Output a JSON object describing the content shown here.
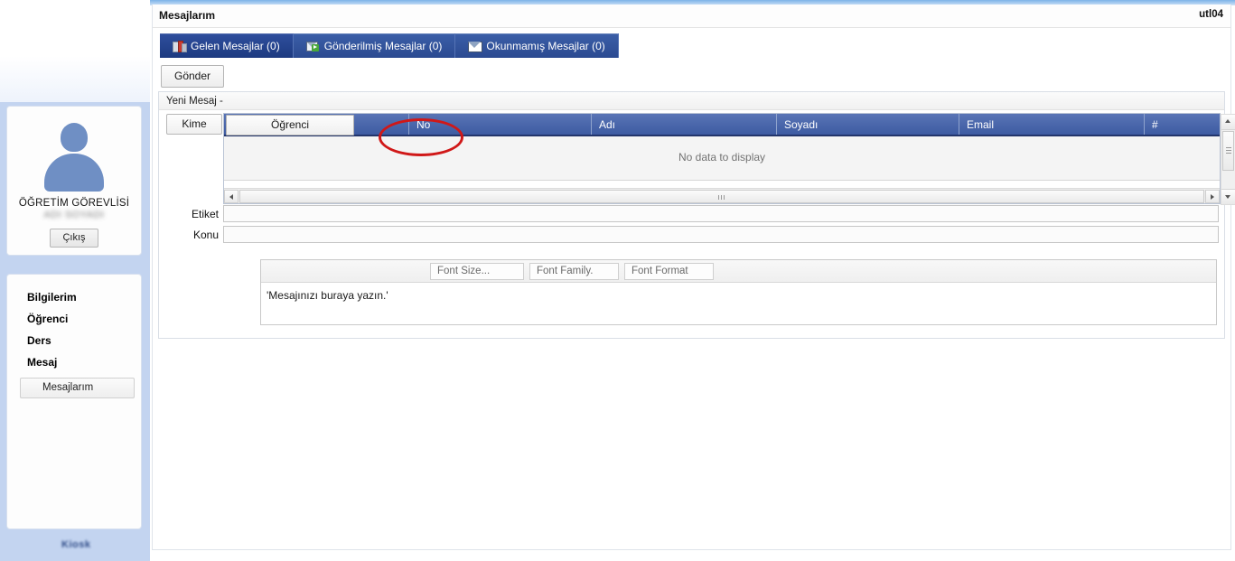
{
  "header": {
    "page_title": "Mesajlarım",
    "user_code": "utl04"
  },
  "sidebar": {
    "user": {
      "role": "ÖĞRETİM GÖREVLİSİ",
      "name": "ADI SOYADI",
      "logout_label": "Çıkış",
      "avatar_icon": "user-avatar-icon"
    },
    "nav_items": [
      {
        "label": "Bilgilerim"
      },
      {
        "label": "Öğrenci"
      },
      {
        "label": "Ders"
      },
      {
        "label": "Mesaj"
      }
    ],
    "sub_items": [
      {
        "label": "Mesajlarım"
      }
    ],
    "brand": "Kiosk"
  },
  "tabs": [
    {
      "label": "Gelen Mesajlar (0)",
      "icon": "inbox-icon",
      "active": true
    },
    {
      "label": "Gönderilmiş Mesajlar (0)",
      "icon": "sent-mail-icon",
      "active": false
    },
    {
      "label": "Okunmamış Mesajlar (0)",
      "icon": "unread-mail-icon",
      "active": false
    }
  ],
  "toolbar": {
    "send_label": "Gönder"
  },
  "message_panel": {
    "title": "Yeni Mesaj -",
    "recipient_label": "Kime",
    "recipient_type_button": "Öğrenci",
    "grid": {
      "columns": [
        "",
        "No",
        "Adı",
        "Soyadı",
        "Email",
        "#"
      ],
      "rows": [],
      "empty_text": "No data to display"
    },
    "fields": [
      {
        "label": "Etiket",
        "value": "",
        "placeholder": ""
      },
      {
        "label": "Konu",
        "value": "",
        "placeholder": ""
      }
    ],
    "editor": {
      "font_size_label": "Font Size...",
      "font_family_label": "Font Family.",
      "font_format_label": "Font Format",
      "body_text": "'Mesajınızı buraya yazın.'"
    }
  },
  "annotation": {
    "shape": "ellipse",
    "color": "#d01818",
    "target": "Öğrenci"
  },
  "colors": {
    "tab_bar": "#2b4a91",
    "grid_header": "#3d5ba2",
    "sidebar_bg": "#c3d4f0",
    "annotation": "#d01818"
  }
}
